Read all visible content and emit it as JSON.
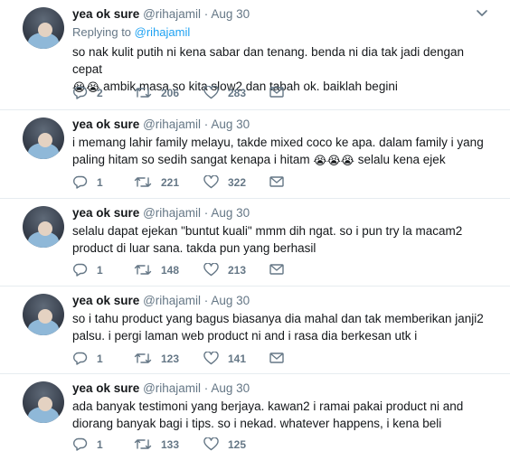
{
  "tweets": [
    {
      "name": "yea ok sure",
      "handle": "@rihajamil",
      "dot": "·",
      "date": "Aug 30",
      "reply_label": "Replying to ",
      "reply_mention": "@rihajamil",
      "text_line1": "so nak kulit putih ni kena sabar dan tenang. benda ni dia tak jadi dengan cepat",
      "text_line2_emoji": "😭😭",
      "text_line2": " ambik masa so kita slow2 dan tabah ok. baiklah begini",
      "replies": "2",
      "retweets": "206",
      "likes": "283"
    },
    {
      "name": "yea ok sure",
      "handle": "@rihajamil",
      "dot": "·",
      "date": "Aug 30",
      "text_line1": "i memang lahir family melayu, takde mixed coco ke apa. dalam family i yang",
      "text_line2": "paling hitam so sedih sangat kenapa i hitam ",
      "text_line2_emoji": "😭😭😭",
      "text_line2_tail": " selalu kena ejek",
      "replies": "1",
      "retweets": "221",
      "likes": "322"
    },
    {
      "name": "yea ok sure",
      "handle": "@rihajamil",
      "dot": "·",
      "date": "Aug 30",
      "text_line1": "selalu dapat ejekan \"buntut kuali\" mmm dih ngat. so i pun try la macam2",
      "text_line2": "product di luar sana. takda pun yang berhasil",
      "replies": "1",
      "retweets": "148",
      "likes": "213"
    },
    {
      "name": "yea ok sure",
      "handle": "@rihajamil",
      "dot": "·",
      "date": "Aug 30",
      "text_line1": "so i tahu product yang bagus biasanya dia mahal dan tak memberikan janji2",
      "text_line2": "palsu. i pergi laman web product ni and i rasa dia berkesan utk i",
      "replies": "1",
      "retweets": "123",
      "likes": "141"
    },
    {
      "name": "yea ok sure",
      "handle": "@rihajamil",
      "dot": "·",
      "date": "Aug 30",
      "text_line1": "ada banyak testimoni yang berjaya. kawan2 i ramai pakai product ni and",
      "text_line2": "diorang banyak bagi i tips. so i nekad. whatever happens, i kena beli",
      "replies": "1",
      "retweets": "133",
      "likes": "125"
    }
  ],
  "icons": {
    "reply": "reply-icon",
    "retweet": "retweet-icon",
    "like": "heart-icon",
    "dm": "envelope-icon",
    "more": "chevron-down-icon"
  },
  "colors": {
    "text": "#14171a",
    "muted": "#657786",
    "link": "#1da1f2",
    "divider": "#e6ecf0"
  }
}
